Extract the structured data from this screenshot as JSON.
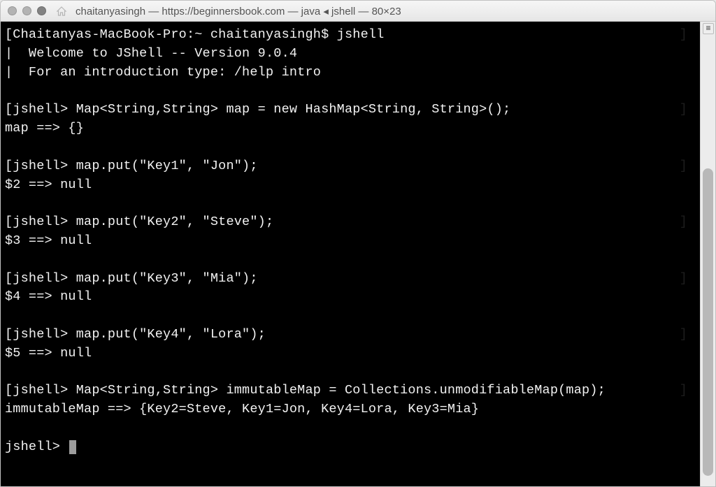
{
  "titlebar": {
    "title": "chaitanyasingh — https://beginnersbook.com — java ◂ jshell — 80×23"
  },
  "terminal": {
    "lines": [
      "[Chaitanyas-MacBook-Pro:~ chaitanyasingh$ jshell",
      "|  Welcome to JShell -- Version 9.0.4",
      "|  For an introduction type: /help intro",
      "",
      "[jshell> Map<String,String> map = new HashMap<String, String>();",
      "map ==> {}",
      "",
      "[jshell> map.put(\"Key1\", \"Jon\");",
      "$2 ==> null",
      "",
      "[jshell> map.put(\"Key2\", \"Steve\");",
      "$3 ==> null",
      "",
      "[jshell> map.put(\"Key3\", \"Mia\");",
      "$4 ==> null",
      "",
      "[jshell> map.put(\"Key4\", \"Lora\");",
      "$5 ==> null",
      "",
      "[jshell> Map<String,String> immutableMap = Collections.unmodifiableMap(map);",
      "immutableMap ==> {Key2=Steve, Key1=Jon, Key4=Lora, Key3=Mia}",
      ""
    ],
    "prompt": "jshell> "
  }
}
